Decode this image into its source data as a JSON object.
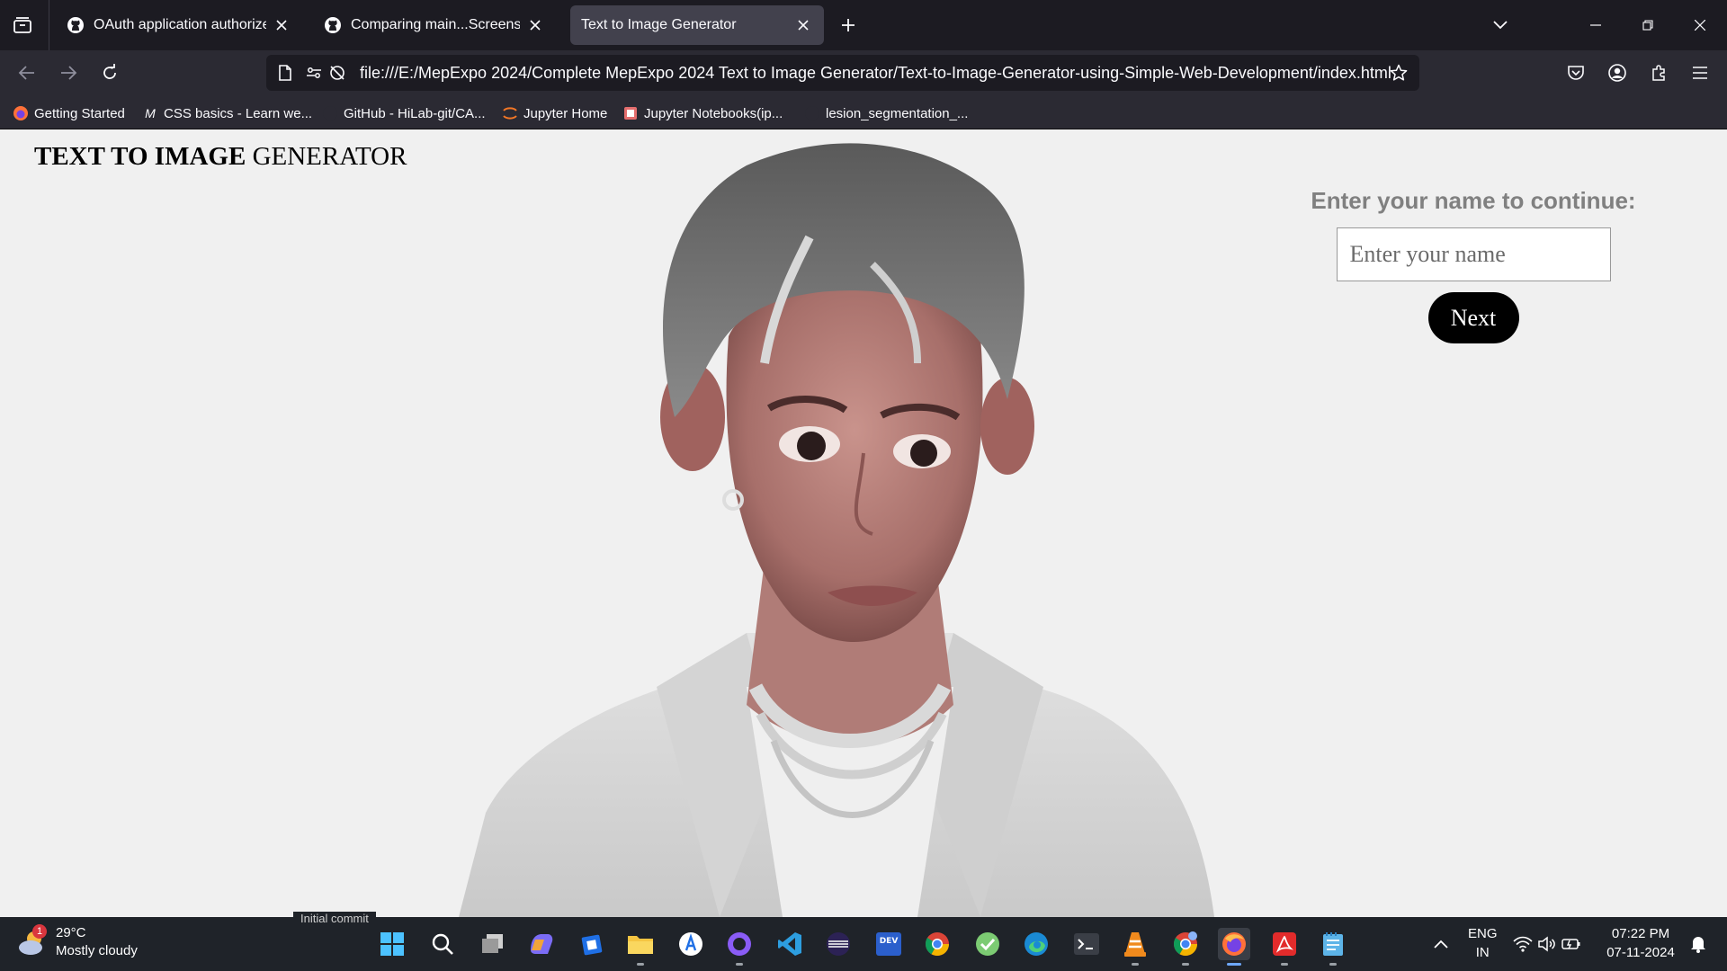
{
  "browser": {
    "tabs": [
      {
        "title": "OAuth application authorized",
        "icon": "github-icon",
        "active": false
      },
      {
        "title": "Comparing main...Screenshot-of",
        "icon": "github-icon",
        "active": false
      },
      {
        "title": "Text to Image Generator",
        "icon": "none",
        "active": true
      }
    ],
    "url": "file:///E:/MepExpo 2024/Complete MepExpo 2024 Text to Image Generator/Text-to-Image-Generator-using-Simple-Web-Development/index.html",
    "bookmarks": [
      {
        "label": "Getting Started",
        "icon": "firefox-icon"
      },
      {
        "label": "CSS basics - Learn we...",
        "icon": "mdn-icon"
      },
      {
        "label": "GitHub - HiLab-git/CA...",
        "icon": "github-icon"
      },
      {
        "label": "Jupyter Home",
        "icon": "jupyter-icon"
      },
      {
        "label": "Jupyter Notebooks(ip...",
        "icon": "notebook-icon"
      },
      {
        "label": "lesion_segmentation_...",
        "icon": "github-icon"
      }
    ]
  },
  "page": {
    "title_bold": "TEXT TO IMAGE",
    "title_rest": " GENERATOR",
    "prompt": "Enter your name to continue:",
    "name_placeholder": "Enter your name",
    "next_label": "Next"
  },
  "taskbar": {
    "weather": {
      "temp": "29°C",
      "desc": "Mostly cloudy",
      "badge": "1"
    },
    "tooltip": "Initial commit",
    "lang_top": "ENG",
    "lang_bottom": "IN",
    "time": "07:22 PM",
    "date": "07-11-2024",
    "apps": [
      "start-icon",
      "search-icon",
      "task-view-icon",
      "copilot-icon",
      "microsoft-store-icon",
      "file-explorer-icon",
      "app-installer-icon",
      "github-desktop-icon",
      "vscode-icon",
      "eclipse-icon",
      "dev-home-icon",
      "chrome-icon",
      "tick-app-icon",
      "edge-icon",
      "terminal-icon",
      "vlc-icon",
      "chrome-profile-icon",
      "firefox-icon",
      "acrobat-icon",
      "notepad-icon"
    ]
  }
}
